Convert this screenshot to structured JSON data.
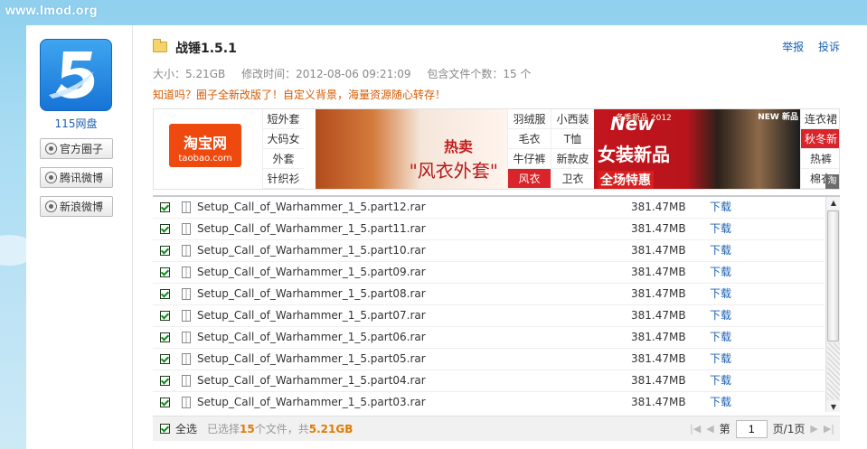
{
  "watermark": "www.lmod.org",
  "sidebar": {
    "product_name": "115网盘",
    "buttons": [
      {
        "label": "官方圈子",
        "icon": "circle-icon"
      },
      {
        "label": "腾讯微博",
        "icon": "tencent-weibo-icon"
      },
      {
        "label": "新浪微博",
        "icon": "sina-weibo-icon"
      }
    ]
  },
  "header": {
    "title": "战锤1.5.1",
    "links": [
      "举报",
      "投诉"
    ],
    "size": "大小：5.21GB",
    "modified": "修改时间：2012-08-06 09:21:09",
    "file_count": "包含文件个数：15 个",
    "notice": "知道吗？圈子全新改版了！自定义背景，海量资源随心转存！"
  },
  "ad": {
    "taobao_logo": "淘宝网",
    "taobao_domain": "taobao.com",
    "cats_left": [
      "短外套",
      "大码女",
      "外套",
      "针织衫"
    ],
    "img1_text1": "热卖",
    "img1_text2": "\"风衣外套\"",
    "cats_mid_a": [
      "羽绒服",
      "毛衣",
      "牛仔裤",
      "风衣"
    ],
    "cats_mid_b": [
      "小西装",
      "T恤",
      "新款皮",
      "卫衣"
    ],
    "img2_new": "New",
    "img2_season": "冬季新品 2012",
    "img2_main": "女装新品",
    "img2_sub": "全场特惠",
    "img2_corner": "NEW 新品",
    "cats_right": [
      "连衣裙",
      "秋冬新",
      "热裤",
      "棉衣"
    ],
    "tag": "淘"
  },
  "files": [
    {
      "name": "Setup_Call_of_Warhammer_1_5.part12.rar",
      "size": "381.47MB",
      "action": "下载"
    },
    {
      "name": "Setup_Call_of_Warhammer_1_5.part11.rar",
      "size": "381.47MB",
      "action": "下载"
    },
    {
      "name": "Setup_Call_of_Warhammer_1_5.part10.rar",
      "size": "381.47MB",
      "action": "下载"
    },
    {
      "name": "Setup_Call_of_Warhammer_1_5.part09.rar",
      "size": "381.47MB",
      "action": "下载"
    },
    {
      "name": "Setup_Call_of_Warhammer_1_5.part08.rar",
      "size": "381.47MB",
      "action": "下载"
    },
    {
      "name": "Setup_Call_of_Warhammer_1_5.part07.rar",
      "size": "381.47MB",
      "action": "下载"
    },
    {
      "name": "Setup_Call_of_Warhammer_1_5.part06.rar",
      "size": "381.47MB",
      "action": "下载"
    },
    {
      "name": "Setup_Call_of_Warhammer_1_5.part05.rar",
      "size": "381.47MB",
      "action": "下载"
    },
    {
      "name": "Setup_Call_of_Warhammer_1_5.part04.rar",
      "size": "381.47MB",
      "action": "下载"
    },
    {
      "name": "Setup_Call_of_Warhammer_1_5.part03.rar",
      "size": "381.47MB",
      "action": "下载"
    }
  ],
  "footer": {
    "select_all": "全选",
    "selected_prefix": "已选择",
    "selected_count": "15",
    "selected_mid": "个文件，共",
    "selected_size": "5.21GB",
    "page_prefix": "第",
    "page_value": "1",
    "page_suffix": "页/1页"
  },
  "colors": {
    "accent": "#1a5fb4",
    "notice": "#d85a00",
    "highlight": "#e07a00",
    "check": "#118d1a"
  }
}
